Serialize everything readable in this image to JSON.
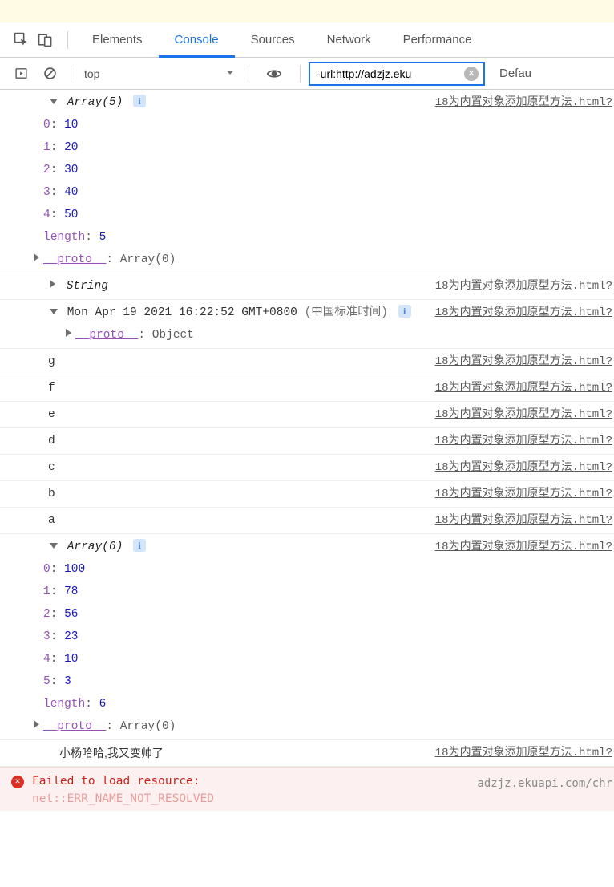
{
  "tabs": {
    "elements": "Elements",
    "console": "Console",
    "sources": "Sources",
    "network": "Network",
    "performance": "Performance"
  },
  "toolbar": {
    "context": "top",
    "filter_value": "-url:http://adzjz.eku",
    "default_label": "Defau"
  },
  "source_link": {
    "prefix": "18",
    "file": "为内置对象添加原型方法.html?"
  },
  "array5": {
    "head": "Array(5)",
    "items": [
      {
        "k": "0",
        "v": "10"
      },
      {
        "k": "1",
        "v": "20"
      },
      {
        "k": "2",
        "v": "30"
      },
      {
        "k": "3",
        "v": "40"
      },
      {
        "k": "4",
        "v": "50"
      }
    ],
    "length_key": "length",
    "length_val": "5",
    "proto_key": "__proto__",
    "proto_val": "Array(0)"
  },
  "string_head": "String",
  "date": {
    "head": "Mon Apr 19 2021 16:22:52 GMT+0800",
    "paren": "(中国标准时间)",
    "proto_key": "__proto__",
    "proto_val": "Object"
  },
  "chars": [
    "g",
    "f",
    "e",
    "d",
    "c",
    "b",
    "a"
  ],
  "array6": {
    "head": "Array(6)",
    "items": [
      {
        "k": "0",
        "v": "100"
      },
      {
        "k": "1",
        "v": "78"
      },
      {
        "k": "2",
        "v": "56"
      },
      {
        "k": "3",
        "v": "23"
      },
      {
        "k": "4",
        "v": "10"
      },
      {
        "k": "5",
        "v": "3"
      }
    ],
    "length_key": "length",
    "length_val": "6",
    "proto_key": "__proto__",
    "proto_val": "Array(0)"
  },
  "text_line": "小杨哈哈,我又变帅了",
  "error": {
    "msg1": "Failed to load resource:",
    "msg2": "net::ERR_NAME_NOT_RESOLVED",
    "src": "adzjz.ekuapi.com/chr"
  }
}
